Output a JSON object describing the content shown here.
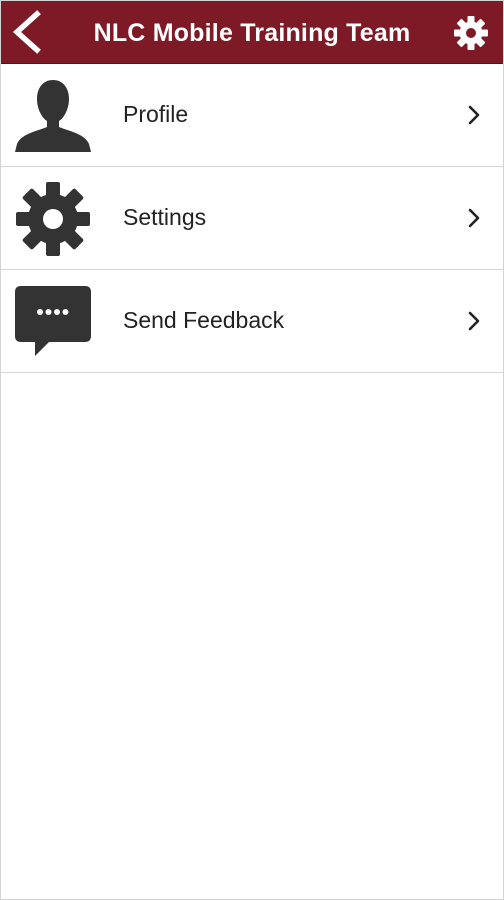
{
  "header": {
    "title": "NLC Mobile Training Team",
    "back_icon": "back-arrow-icon",
    "settings_icon": "gear-icon",
    "background_color": "#7d1a26",
    "text_color": "#ffffff"
  },
  "menu": {
    "items": [
      {
        "label": "Profile",
        "icon": "person-icon"
      },
      {
        "label": "Settings",
        "icon": "gear-icon"
      },
      {
        "label": "Send Feedback",
        "icon": "chat-bubble-icon"
      }
    ],
    "chevron_icon": "chevron-right-icon"
  }
}
